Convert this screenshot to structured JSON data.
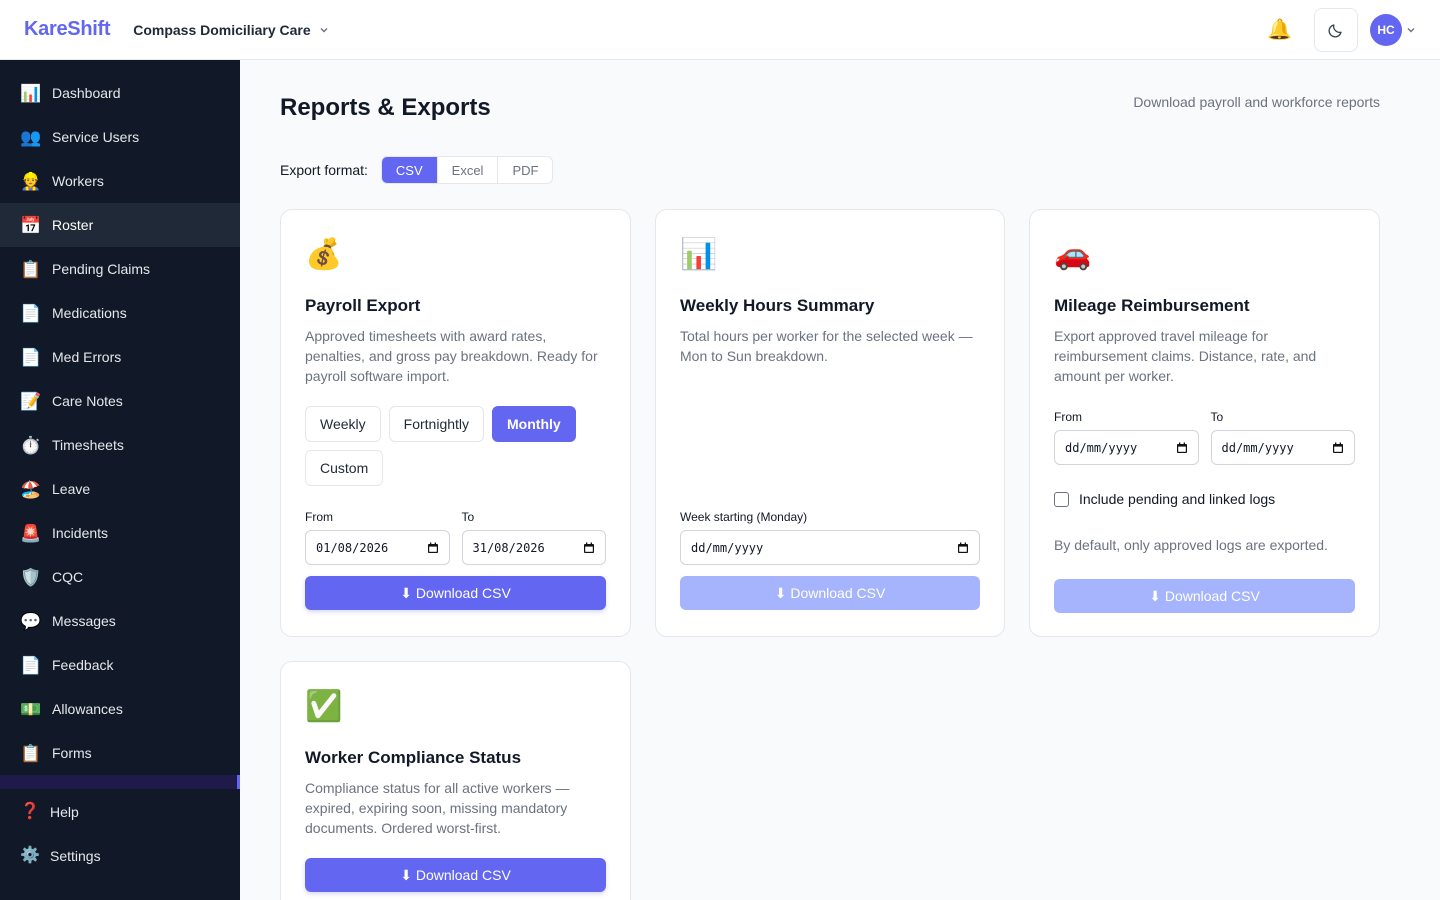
{
  "app": {
    "brand": "KareShift",
    "org": "Compass Domiciliary Care",
    "user_initials": "HC"
  },
  "sidebar": {
    "items": [
      {
        "label": "Dashboard",
        "icon": "📊"
      },
      {
        "label": "Service Users",
        "icon": "👥"
      },
      {
        "label": "Workers",
        "icon": "👷"
      },
      {
        "label": "Roster",
        "icon": "📅"
      },
      {
        "label": "Pending Claims",
        "icon": "📋"
      },
      {
        "label": "Medications",
        "icon": "📄"
      },
      {
        "label": "Med Errors",
        "icon": "📄"
      },
      {
        "label": "Care Notes",
        "icon": "📝"
      },
      {
        "label": "Timesheets",
        "icon": "⏱️"
      },
      {
        "label": "Leave",
        "icon": "🏖️"
      },
      {
        "label": "Incidents",
        "icon": "🚨"
      },
      {
        "label": "CQC",
        "icon": "🛡️"
      },
      {
        "label": "Messages",
        "icon": "💬"
      },
      {
        "label": "Feedback",
        "icon": "📄"
      },
      {
        "label": "Allowances",
        "icon": "💵"
      },
      {
        "label": "Forms",
        "icon": "📋"
      }
    ],
    "active": "Roster",
    "bottom": [
      {
        "label": "Help",
        "icon": "❓"
      },
      {
        "label": "Settings",
        "icon": "⚙️"
      }
    ]
  },
  "page": {
    "title": "Reports & Exports",
    "subtitle": "Download payroll and workforce reports",
    "format_label": "Export format:",
    "formats": [
      "CSV",
      "Excel",
      "PDF"
    ],
    "selected_format": "CSV"
  },
  "cards": {
    "payroll": {
      "icon": "💰",
      "title": "Payroll Export",
      "desc": "Approved timesheets with award rates, penalties, and gross pay breakdown. Ready for payroll software import.",
      "periods": [
        "Weekly",
        "Fortnightly",
        "Monthly",
        "Custom"
      ],
      "selected_period": "Monthly",
      "from_label": "From",
      "from_value": "01/08/2026",
      "to_label": "To",
      "to_value": "31/08/2026",
      "button": "⬇ Download CSV"
    },
    "weekly": {
      "icon": "📊",
      "title": "Weekly Hours Summary",
      "desc": "Total hours per worker for the selected week — Mon to Sun breakdown.",
      "week_label": "Week starting (Monday)",
      "week_value": "dd/mm/yyyy",
      "button": "⬇ Download CSV"
    },
    "mileage": {
      "icon": "🚗",
      "title": "Mileage Reimbursement",
      "desc": "Export approved travel mileage for reimbursement claims. Distance, rate, and amount per worker.",
      "from_label": "From",
      "from_value": "dd/mm/yyyy",
      "to_label": "To",
      "to_value": "dd/mm/yyyy",
      "checkbox_label": "Include pending and linked logs",
      "checkbox_checked": false,
      "note": "By default, only approved logs are exported.",
      "button": "⬇ Download CSV"
    },
    "compliance": {
      "icon": "✅",
      "title": "Worker Compliance Status",
      "desc": "Compliance status for all active workers — expired, expiring soon, missing mandatory documents. Ordered worst-first.",
      "button": "⬇ Download CSV"
    }
  }
}
